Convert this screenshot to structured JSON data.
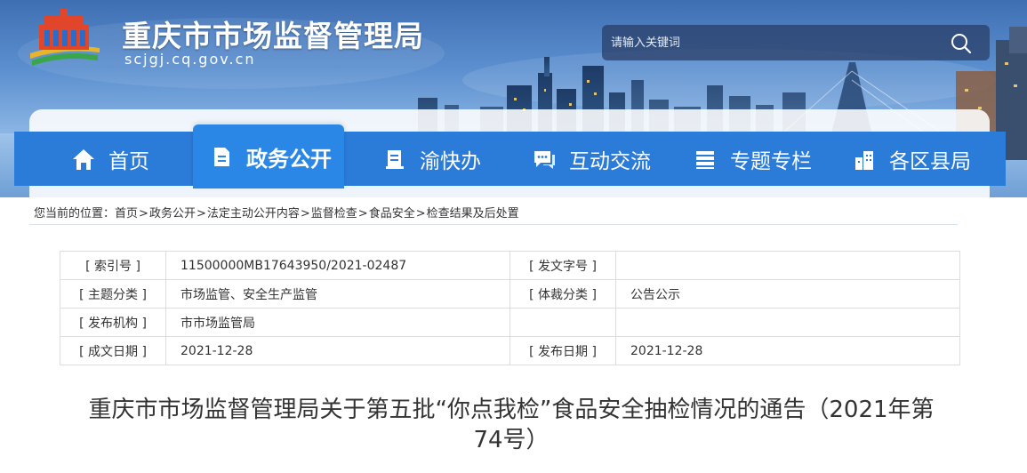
{
  "site": {
    "name": "重庆市市场监督管理局",
    "domain": "scjgj.cq.gov.cn"
  },
  "search": {
    "placeholder": "请输入关键词",
    "icon": "search-icon"
  },
  "nav": {
    "items": [
      {
        "label": "首页",
        "icon": "home-icon"
      },
      {
        "label": "政务公开",
        "icon": "document-icon",
        "active": true
      },
      {
        "label": "渝快办",
        "icon": "book-icon"
      },
      {
        "label": "互动交流",
        "icon": "chat-icon"
      },
      {
        "label": "专题专栏",
        "icon": "stack-icon"
      },
      {
        "label": "各区县局",
        "icon": "building-icon"
      }
    ]
  },
  "breadcrumb": {
    "prefix": "您当前的位置：",
    "items": [
      "首页",
      "政务公开",
      "法定主动公开内容",
      "监督检查",
      "食品安全",
      "检查结果及后处置"
    ],
    "separator": ">"
  },
  "meta": {
    "rows": [
      {
        "k1": "[ 索引号 ]",
        "v1": "11500000MB17643950/2021-02487",
        "k2": "[ 发文字号 ]",
        "v2": ""
      },
      {
        "k1": "[ 主题分类 ]",
        "v1": "市场监管、安全生产监管",
        "k2": "[ 体裁分类 ]",
        "v2": "公告公示"
      },
      {
        "k1": "[ 发布机构 ]",
        "v1": "市市场监管局",
        "k2": "",
        "v2": ""
      },
      {
        "k1": "[ 成文日期 ]",
        "v1": "2021-12-28",
        "k2": "[ 发布日期 ]",
        "v2": "2021-12-28"
      }
    ]
  },
  "article": {
    "title_line1": "重庆市市场监督管理局关于第五批“你点我检”食品安全抽检情况的通告（2021年第",
    "title_line2": "74号）"
  },
  "colors": {
    "nav_bg": "#2b7bd8",
    "nav_active": "#2a87e6",
    "text": "#333333"
  }
}
